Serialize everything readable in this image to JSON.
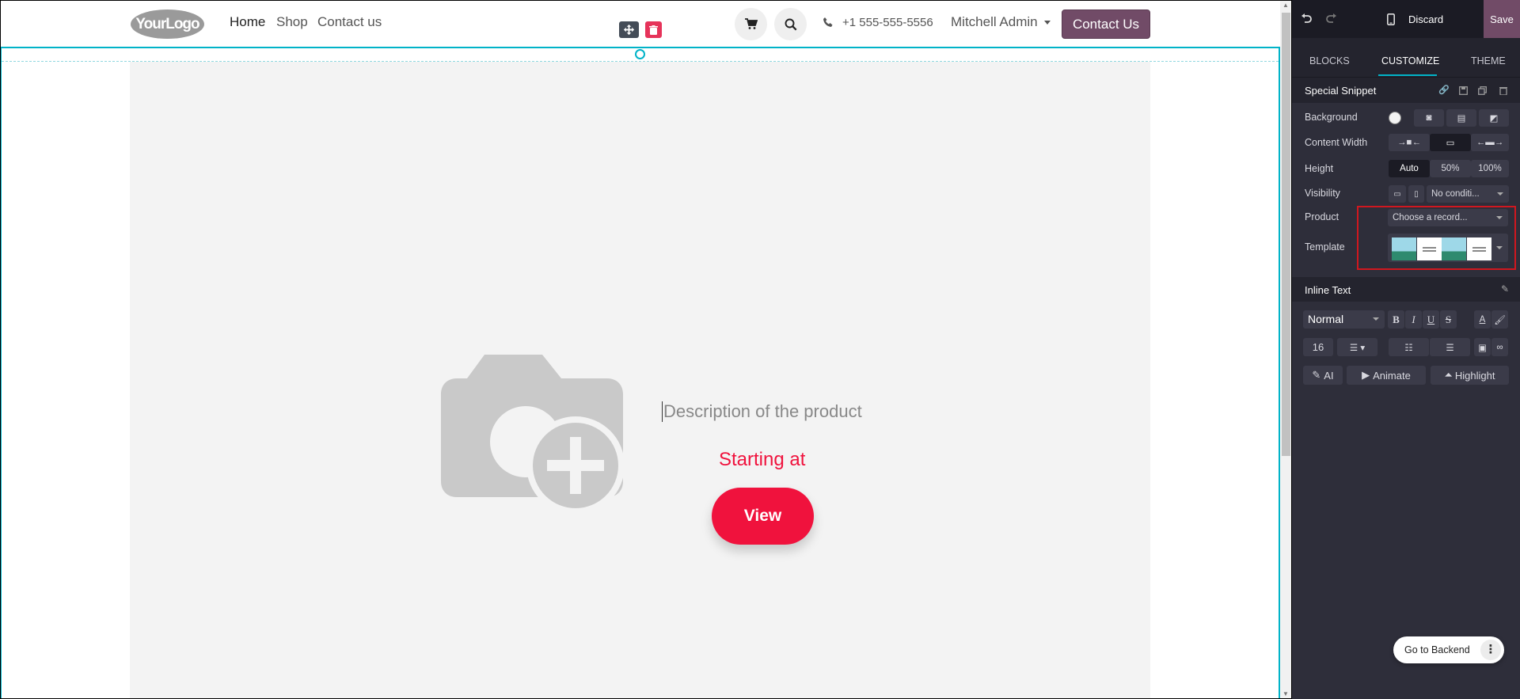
{
  "site": {
    "logo_text": "YourLogo",
    "nav": [
      {
        "label": "Home"
      },
      {
        "label": "Shop"
      },
      {
        "label": "Contact us"
      }
    ],
    "phone": "+1 555-555-5556",
    "user": "Mitchell Admin",
    "contact_button": "Contact Us"
  },
  "snippet": {
    "description": "Description of the product",
    "starting_at": "Starting at",
    "view_button": "View"
  },
  "panel": {
    "discard": "Discard",
    "save": "Save",
    "tabs": [
      {
        "label": "BLOCKS"
      },
      {
        "label": "CUSTOMIZE"
      },
      {
        "label": "THEME"
      }
    ],
    "active_tab": "CUSTOMIZE",
    "section_title": "Special Snippet",
    "rows": {
      "background": "Background",
      "content_width": "Content Width",
      "height": "Height",
      "visibility": "Visibility",
      "product": "Product",
      "template": "Template"
    },
    "height_options": [
      "Auto",
      "50%",
      "100%"
    ],
    "visibility_value": "No conditi...",
    "product_placeholder": "Choose a record...",
    "inline_text_title": "Inline Text",
    "text_style": "Normal",
    "font_size": "16",
    "format_buttons": [
      "B",
      "I",
      "U",
      "S"
    ],
    "ai_button": "AI",
    "animate_button": "Animate",
    "highlight_button": "Highlight",
    "go_to_backend": "Go to Backend"
  },
  "colors": {
    "accent": "#714b67",
    "selection": "#01b3c8",
    "product_red": "#f0123d",
    "panel_bg": "#2e2e3a"
  }
}
